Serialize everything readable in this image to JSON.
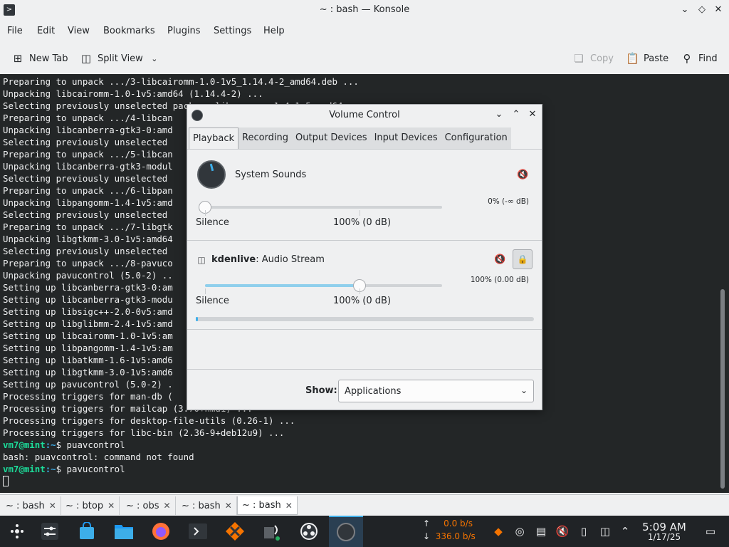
{
  "konsole": {
    "title": "~ : bash — Konsole",
    "menu": [
      "File",
      "Edit",
      "View",
      "Bookmarks",
      "Plugins",
      "Settings",
      "Help"
    ],
    "toolbar": {
      "new_tab": "New Tab",
      "split_view": "Split View",
      "copy": "Copy",
      "paste": "Paste",
      "find": "Find"
    },
    "terminal_lines": [
      "Preparing to unpack .../3-libcairomm-1.0-1v5_1.14.4-2_amd64.deb ...",
      "Unpacking libcairomm-1.0-1v5:amd64 (1.14.4-2) ...",
      "Selecting previously unselected package libpangomm-1.4-1v5:amd64.",
      "Preparing to unpack .../4-libcan",
      "Unpacking libcanberra-gtk3-0:amd",
      "Selecting previously unselected",
      "Preparing to unpack .../5-libcan",
      "Unpacking libcanberra-gtk3-modul",
      "Selecting previously unselected",
      "Preparing to unpack .../6-libpan",
      "Unpacking libpangomm-1.4-1v5:amd",
      "Selecting previously unselected",
      "Preparing to unpack .../7-libgtk",
      "Unpacking libgtkmm-3.0-1v5:amd64",
      "Selecting previously unselected",
      "Preparing to unpack .../8-pavuco",
      "Unpacking pavucontrol (5.0-2) ..",
      "Setting up libcanberra-gtk3-0:am",
      "Setting up libcanberra-gtk3-modu",
      "Setting up libsigc++-2.0-0v5:amd",
      "Setting up libglibmm-2.4-1v5:amd",
      "Setting up libcairomm-1.0-1v5:am",
      "Setting up libpangomm-1.4-1v5:am",
      "Setting up libatkmm-1.6-1v5:amd6",
      "Setting up libgtkmm-3.0-1v5:amd6",
      "Setting up pavucontrol (5.0-2) .",
      "Processing triggers for man-db (",
      "Processing triggers for mailcap (3.70+nmu1) ...",
      "Processing triggers for desktop-file-utils (0.26-1) ...",
      "Processing triggers for libc-bin (2.36-9+deb12u9) ..."
    ],
    "prompt_user": "vm7@mint",
    "prompt_path": ":~",
    "prompt_sym": "$ ",
    "cmd1": "puavcontrol",
    "error_line": "bash: puavcontrol: command not found",
    "cmd2": "pavucontrol",
    "tabs": [
      {
        "label": "~ : bash",
        "active": false
      },
      {
        "label": "~ : btop",
        "active": false
      },
      {
        "label": "~ : obs",
        "active": false
      },
      {
        "label": "~ : bash",
        "active": false
      },
      {
        "label": "~ : bash",
        "active": true
      }
    ]
  },
  "volume_control": {
    "title": "Volume Control",
    "tabs": [
      "Playback",
      "Recording",
      "Output Devices",
      "Input Devices",
      "Configuration"
    ],
    "active_tab": "Playback",
    "streams": [
      {
        "name": "System Sounds",
        "app_name": "",
        "level_text": "0% (-∞ dB)",
        "volume_fraction": 0.0,
        "silence_label": "Silence",
        "hundred_label": "100% (0 dB)"
      },
      {
        "name": ": Audio Stream",
        "app_name": "kdenlive",
        "level_text": "100% (0.00 dB)",
        "volume_fraction": 1.0,
        "silence_label": "Silence",
        "hundred_label": "100% (0 dB)",
        "peak_fraction": 0.01
      }
    ],
    "show_label": "Show:",
    "show_value": "Applications"
  },
  "taskbar": {
    "net_up": "0.0 b/s",
    "net_down": "336.0 b/s",
    "time": "5:09 AM",
    "date": "1/17/25",
    "colors": {
      "accent": "#3daee9",
      "net_value": "#f67400",
      "panel": "#202326"
    }
  }
}
